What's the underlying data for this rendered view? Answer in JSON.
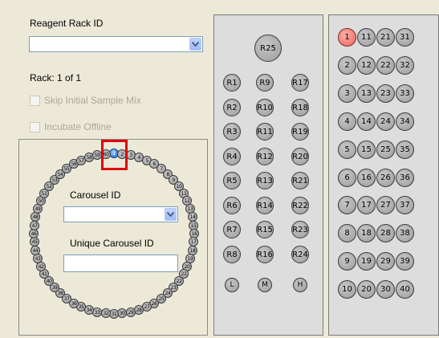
{
  "reagent": {
    "label": "Reagent Rack ID",
    "combo_value": "",
    "rack_text": "Rack:  1 of 1",
    "skip_label": "Skip Initial Sample Mix",
    "incubate_label": "Incubate Offline"
  },
  "carousel": {
    "id_label": "Carousel ID",
    "id_value": "",
    "unique_label": "Unique Carousel ID",
    "unique_value": "",
    "selected_position": "1",
    "positions": [
      "1",
      "2",
      "3",
      "4",
      "5",
      "6",
      "7",
      "8",
      "9",
      "10",
      "11",
      "12",
      "13",
      "14",
      "15",
      "16",
      "17",
      "18",
      "19",
      "20",
      "21",
      "22",
      "23",
      "24",
      "25",
      "26",
      "27",
      "28",
      "29",
      "30",
      "31",
      "32",
      "33",
      "34",
      "35",
      "36",
      "37",
      "38",
      "39",
      "40",
      "41",
      "42",
      "43",
      "44",
      "45",
      "46",
      "47",
      "48",
      "49",
      "50",
      "51",
      "52",
      "53",
      "54",
      "55",
      "56",
      "57",
      "58",
      "59",
      "60"
    ]
  },
  "reagent_rack": {
    "top": "R25",
    "columns": [
      [
        "R1",
        "R2",
        "R3",
        "R4",
        "R5",
        "R6",
        "R7",
        "R8"
      ],
      [
        "R9",
        "R10",
        "R11",
        "R12",
        "R13",
        "R14",
        "R15",
        "R16"
      ],
      [
        "R17",
        "R18",
        "R19",
        "R20",
        "R21",
        "R22",
        "R23",
        "R24"
      ]
    ],
    "bottom": [
      "L",
      "M",
      "H"
    ]
  },
  "sample_rack": {
    "highlighted": "1",
    "highlight_color": "#f27a70",
    "columns": [
      [
        "1",
        "2",
        "3",
        "4",
        "5",
        "6",
        "7",
        "8",
        "9",
        "10"
      ],
      [
        "11",
        "12",
        "13",
        "14",
        "15",
        "16",
        "17",
        "18",
        "19",
        "20"
      ],
      [
        "21",
        "22",
        "23",
        "24",
        "25",
        "26",
        "27",
        "28",
        "29",
        "30"
      ],
      [
        "31",
        "32",
        "33",
        "34",
        "35",
        "36",
        "37",
        "38",
        "39",
        "40"
      ]
    ]
  }
}
